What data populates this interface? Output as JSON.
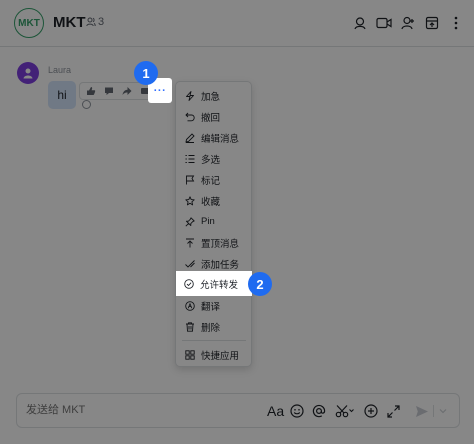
{
  "header": {
    "avatar_text": "MKT",
    "title": "MKT",
    "member_count": "3"
  },
  "message": {
    "sender": "Laura",
    "text": "hi"
  },
  "more_button": {
    "label": "···"
  },
  "menu": {
    "items": [
      "加急",
      "撤回",
      "编辑消息",
      "多选",
      "标记",
      "收藏",
      "Pin",
      "置顶消息",
      "添加任务",
      "允许转发",
      "翻译",
      "删除",
      "快捷应用"
    ]
  },
  "badges": {
    "step1": "1",
    "step2": "2"
  },
  "composer": {
    "placeholder": "发送给 MKT",
    "font_button_label": "Aa"
  },
  "colors": {
    "accent": "#3370ff",
    "badge": "#1f6bf0",
    "group_avatar": "#35a06a",
    "user_avatar": "#7f3fe0",
    "bubble": "#d4e4fc"
  }
}
